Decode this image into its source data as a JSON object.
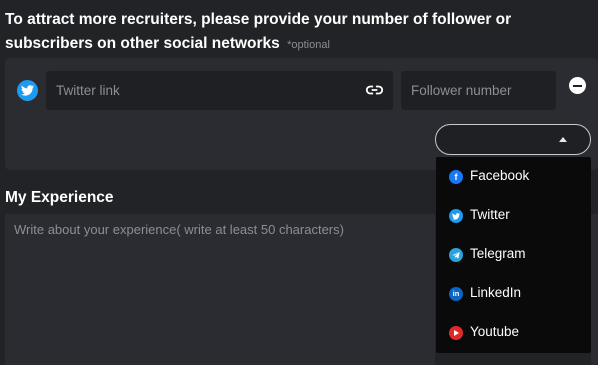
{
  "social": {
    "heading": "To attract more recruiters, please provide your number of follower or subscribers on other social networks",
    "optional_note": "*optional",
    "link_placeholder": "Twitter link",
    "follower_placeholder": "Follower number",
    "select_value": "",
    "options": [
      {
        "label": "Facebook",
        "icon": "facebook-icon",
        "color": "#1877f2"
      },
      {
        "label": "Twitter",
        "icon": "twitter-icon",
        "color": "#1d9bf0"
      },
      {
        "label": "Telegram",
        "icon": "telegram-icon",
        "color": "#2aa3dc"
      },
      {
        "label": "LinkedIn",
        "icon": "linkedin-icon",
        "color": "#0a66c2"
      },
      {
        "label": "Youtube",
        "icon": "youtube-icon",
        "color": "#e02a2a"
      }
    ]
  },
  "experience": {
    "title": "My Experience",
    "placeholder": "Write about your experience( write at least 50 characters)"
  },
  "colors": {
    "background": "#222327",
    "panel": "#2b2c31",
    "input": "#1f2024",
    "dropdown": "#0a0a0b"
  }
}
